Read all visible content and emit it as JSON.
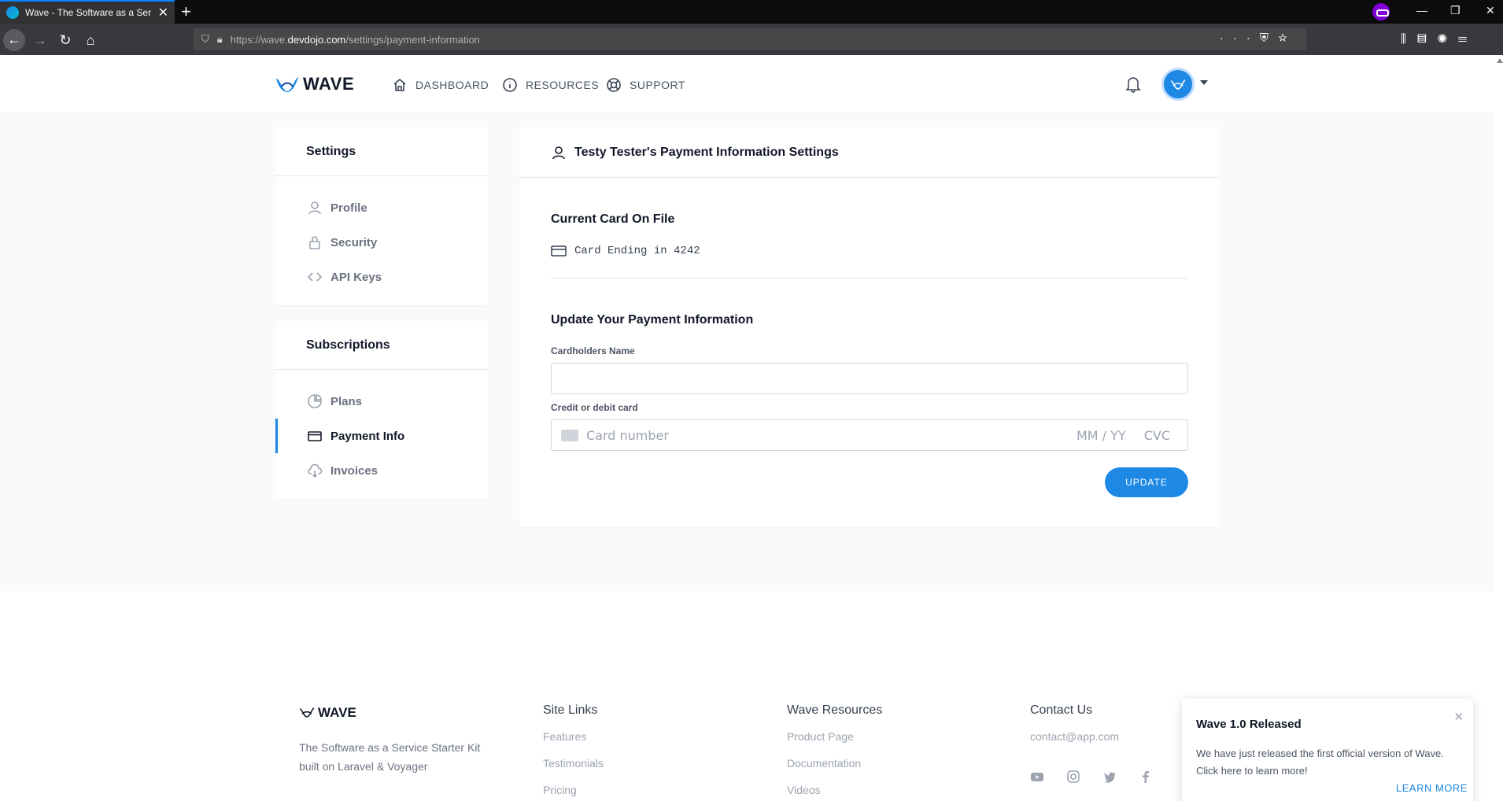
{
  "browser": {
    "tab_title": "Wave - The Software as a Service",
    "url_prefix": "https://wave.",
    "url_domain": "devdojo.com",
    "url_path": "/settings/payment-information",
    "url_full": "https://wave.devdojo.com/settings/payment-information"
  },
  "header": {
    "logo_text": "WAVE",
    "nav": [
      {
        "label": "DASHBOARD",
        "icon": "home-icon"
      },
      {
        "label": "RESOURCES",
        "icon": "info-icon"
      },
      {
        "label": "SUPPORT",
        "icon": "lifebuoy-icon"
      }
    ]
  },
  "sidebar": {
    "settings_title": "Settings",
    "settings_items": [
      {
        "label": "Profile",
        "icon": "user-icon"
      },
      {
        "label": "Security",
        "icon": "lock-icon"
      },
      {
        "label": "API Keys",
        "icon": "code-icon"
      }
    ],
    "subscriptions_title": "Subscriptions",
    "subscription_items": [
      {
        "label": "Plans",
        "icon": "pie-chart-icon"
      },
      {
        "label": "Payment Info",
        "icon": "credit-card-icon",
        "active": true
      },
      {
        "label": "Invoices",
        "icon": "cloud-download-icon"
      }
    ]
  },
  "content": {
    "title": "Testy Tester's Payment Information Settings",
    "current_card_title": "Current Card On File",
    "card_text": "Card Ending in 4242",
    "update_title": "Update Your Payment Information",
    "name_label": "Cardholders Name",
    "name_value": "",
    "card_label": "Credit or debit card",
    "card_placeholder": "Card number",
    "card_expiry_placeholder": "MM / YY",
    "card_cvc_placeholder": "CVC",
    "update_button": "UPDATE"
  },
  "footer": {
    "logo_text": "WAVE",
    "description": "The Software as a Service Starter Kit built on Laravel & Voyager",
    "site_links_title": "Site Links",
    "site_links": [
      "Features",
      "Testimonials",
      "Pricing"
    ],
    "resources_title": "Wave Resources",
    "resources": [
      "Product Page",
      "Documentation",
      "Videos"
    ],
    "contact_title": "Contact Us",
    "contact_email": "contact@app.com",
    "socials": [
      "youtube-icon",
      "instagram-icon",
      "twitter-icon",
      "facebook-icon"
    ]
  },
  "toast": {
    "title": "Wave 1.0 Released",
    "message": "We have just released the first official version of Wave. Click here to learn more!",
    "action": "LEARN MORE"
  },
  "colors": {
    "accent": "#1e88e5",
    "page_bg": "#f9fafc",
    "chrome_dark": "#0c0c0d",
    "toolbar": "#38383d"
  }
}
